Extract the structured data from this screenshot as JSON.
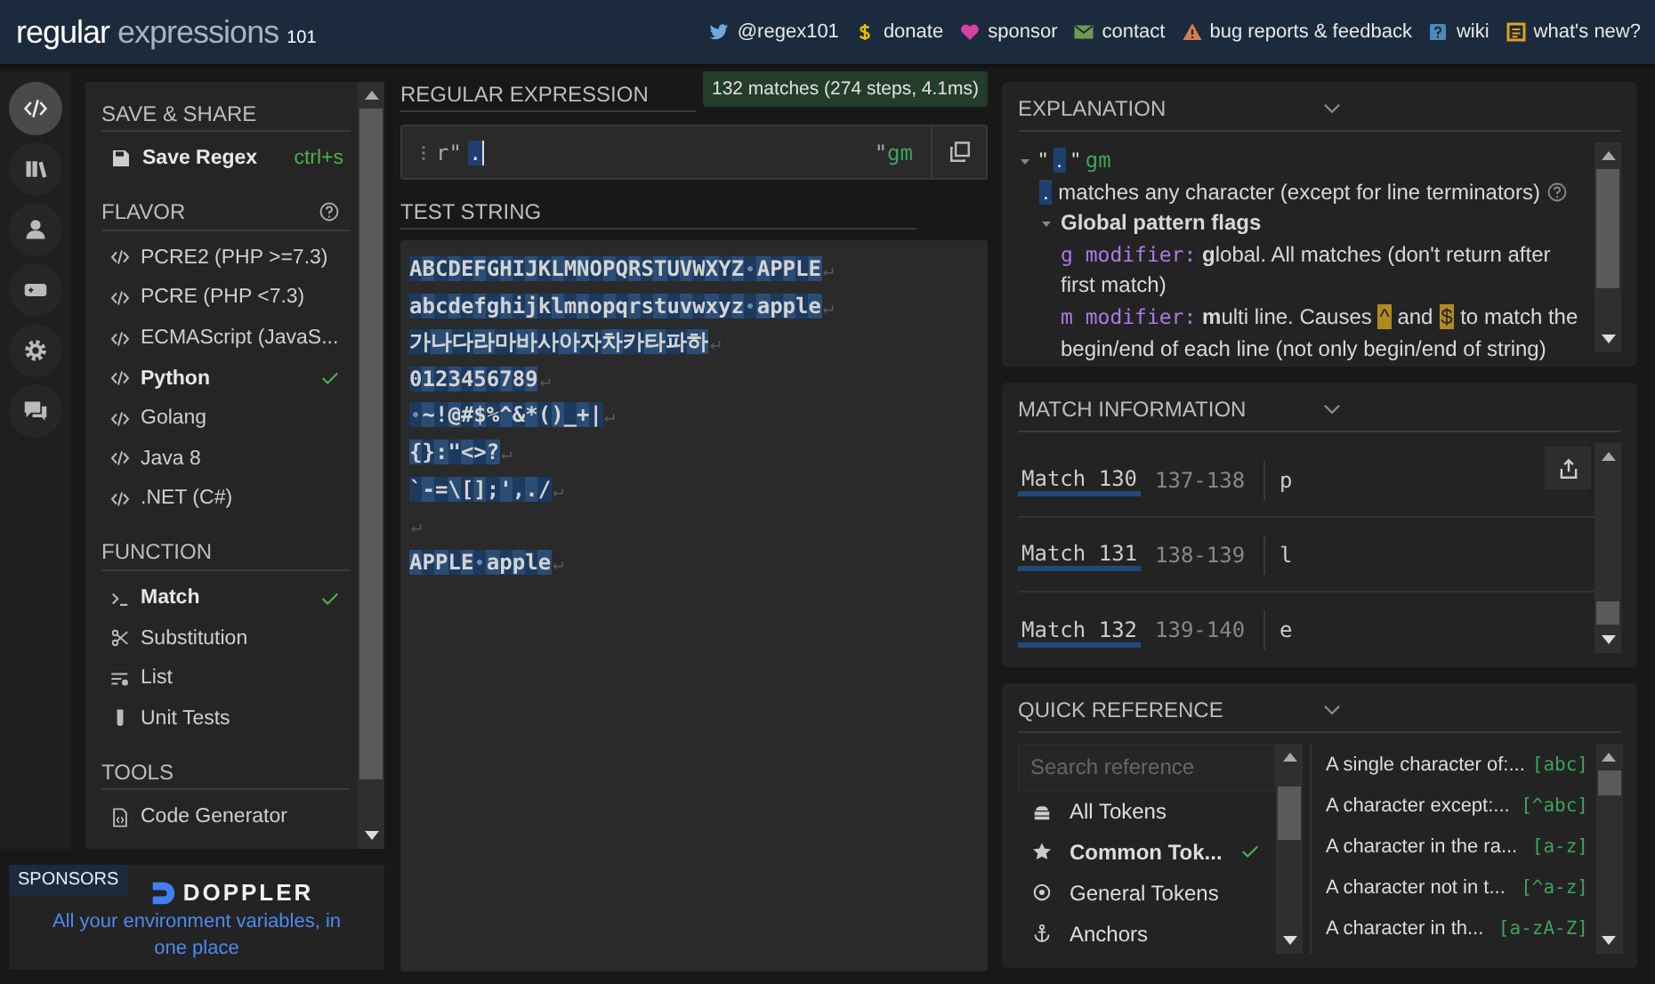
{
  "header": {
    "logo": {
      "name": "regular",
      "subtitle": "expressions",
      "version": "101"
    },
    "links": [
      {
        "label": "@regex101"
      },
      {
        "label": "donate"
      },
      {
        "label": "sponsor"
      },
      {
        "label": "contact"
      },
      {
        "label": "bug reports & feedback"
      },
      {
        "label": "wiki"
      },
      {
        "label": "what's new?"
      }
    ]
  },
  "rail": [
    {
      "selected": true
    },
    {
      "selected": false
    },
    {
      "selected": false
    },
    {
      "selected": false
    },
    {
      "selected": false
    },
    {
      "selected": false
    }
  ],
  "sidebar": {
    "save_share": {
      "title": "SAVE & SHARE",
      "save_label": "Save Regex",
      "shortcut": "ctrl+s"
    },
    "flavor": {
      "title": "FLAVOR",
      "items": [
        {
          "label": "PCRE2 (PHP >=7.3)",
          "selected": false
        },
        {
          "label": "PCRE (PHP <7.3)",
          "selected": false
        },
        {
          "label": "ECMAScript (JavaS...",
          "selected": false
        },
        {
          "label": "Python",
          "selected": true
        },
        {
          "label": "Golang",
          "selected": false
        },
        {
          "label": "Java 8",
          "selected": false
        },
        {
          "label": ".NET (C#)",
          "selected": false
        }
      ]
    },
    "function": {
      "title": "FUNCTION",
      "items": [
        {
          "label": "Match",
          "selected": true
        },
        {
          "label": "Substitution",
          "selected": false
        },
        {
          "label": "List",
          "selected": false
        },
        {
          "label": "Unit Tests",
          "selected": false
        }
      ]
    },
    "tools": {
      "title": "TOOLS",
      "items": [
        {
          "label": "Code Generator"
        }
      ]
    }
  },
  "sponsors": {
    "tag": "SPONSORS",
    "brand": "DOPPLER",
    "tagline": "All your environment variables, in one place"
  },
  "regex": {
    "title": "REGULAR EXPRESSION",
    "match_badge": "132 matches (274 steps, 4.1ms)",
    "prefix": "r\"",
    "pattern": ".",
    "suffix": "\"",
    "flags": "gm"
  },
  "test_string": {
    "title": "TEST STRING",
    "eol_mark": "↵",
    "lines": [
      {
        "kind": "text",
        "text": "ABCDEFGHIJKLMNOPQRSTUVWXYZ APPLE"
      },
      {
        "kind": "text",
        "text": "abcdefghijklmnopqrstuvwxyz apple"
      },
      {
        "kind": "text",
        "text": "가나다라마바사아자차카타파하"
      },
      {
        "kind": "text",
        "text": "0123456789"
      },
      {
        "kind": "text",
        "text": " ~!@#$%^&*()_+|"
      },
      {
        "kind": "text",
        "text": "{}:\"<>?"
      },
      {
        "kind": "text",
        "text": "`-=\\[];',./"
      },
      {
        "kind": "blank"
      },
      {
        "kind": "text",
        "text": "APPLE apple"
      }
    ]
  },
  "explanation": {
    "title": "EXPLANATION",
    "root": {
      "quote_open": "\"",
      "pattern": ".",
      "quote_close": "\"",
      "flags": "gm",
      "expanded": true
    },
    "token": {
      "token": ".",
      "text": "matches any character (except for line terminators)"
    },
    "group": {
      "label": "Global pattern flags",
      "expanded": true,
      "flags": [
        {
          "flag": "g modifier:",
          "parts": [
            {
              "kind": "text",
              "text": "**g**lobal. All matches (don't return after first match)"
            }
          ]
        },
        {
          "flag": "m modifier:",
          "parts": [
            {
              "kind": "text",
              "text": "**m**ulti line. Causes "
            },
            {
              "kind": "token",
              "text": "^"
            },
            {
              "kind": "text",
              "text": " and "
            },
            {
              "kind": "token",
              "text": "$"
            },
            {
              "kind": "text",
              "text": " to match the begin/end of each line (not only begin/end of string)"
            }
          ]
        }
      ]
    }
  },
  "match_information": {
    "title": "MATCH INFORMATION",
    "rows": [
      {
        "label": "Match 130",
        "range": "137-138",
        "value": "p"
      },
      {
        "label": "Match 131",
        "range": "138-139",
        "value": "l"
      },
      {
        "label": "Match 132",
        "range": "139-140",
        "value": "e"
      }
    ]
  },
  "quick_reference": {
    "title": "QUICK REFERENCE",
    "search": {
      "placeholder": "Search reference"
    },
    "categories": [
      {
        "label": "All Tokens",
        "selected": false
      },
      {
        "label": "Common Tok...",
        "selected": true
      },
      {
        "label": "General Tokens",
        "selected": false
      },
      {
        "label": "Anchors",
        "selected": false
      }
    ],
    "entries": [
      {
        "text": "A single character of:...",
        "token": "[abc]"
      },
      {
        "text": "A character except:...",
        "token": "[^abc]"
      },
      {
        "text": "A character in the ra...",
        "token": "[a-z]"
      },
      {
        "text": "A character not in t...",
        "token": "[^a-z]"
      },
      {
        "text": "A character in th...",
        "token": "[a-zA-Z]"
      }
    ]
  }
}
